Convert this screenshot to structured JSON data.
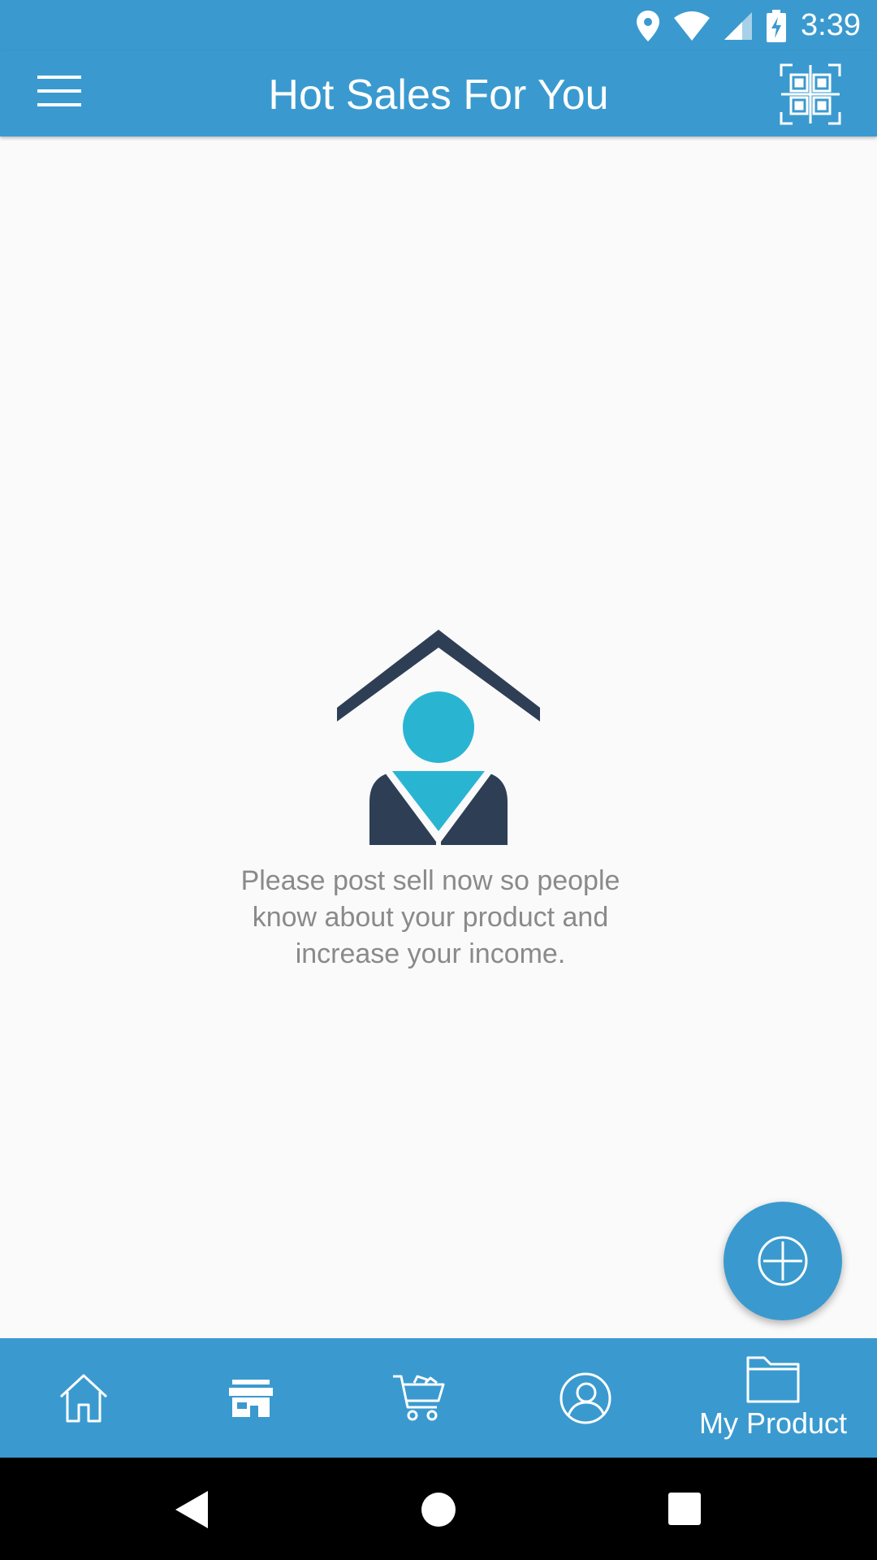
{
  "status_bar": {
    "time": "3:39"
  },
  "app_bar": {
    "title": "Hot Sales For You",
    "menu_icon": "hamburger-menu-icon",
    "qr_icon": "qr-scan-icon"
  },
  "empty_state": {
    "illustration": "seller-house-icon",
    "message": "Please post sell now so people know about your product and increase your income."
  },
  "fab": {
    "icon": "plus-circle-icon"
  },
  "bottom_nav": {
    "items": [
      {
        "icon": "home-icon",
        "label": ""
      },
      {
        "icon": "store-icon",
        "label": ""
      },
      {
        "icon": "cart-icon",
        "label": ""
      },
      {
        "icon": "profile-icon",
        "label": ""
      },
      {
        "icon": "folder-icon",
        "label": "My Product"
      }
    ]
  },
  "colors": {
    "primary": "#3a9acf",
    "illustration_dark": "#2e3f55",
    "illustration_accent": "#29b5d2",
    "message_text": "#8a8a8a"
  }
}
